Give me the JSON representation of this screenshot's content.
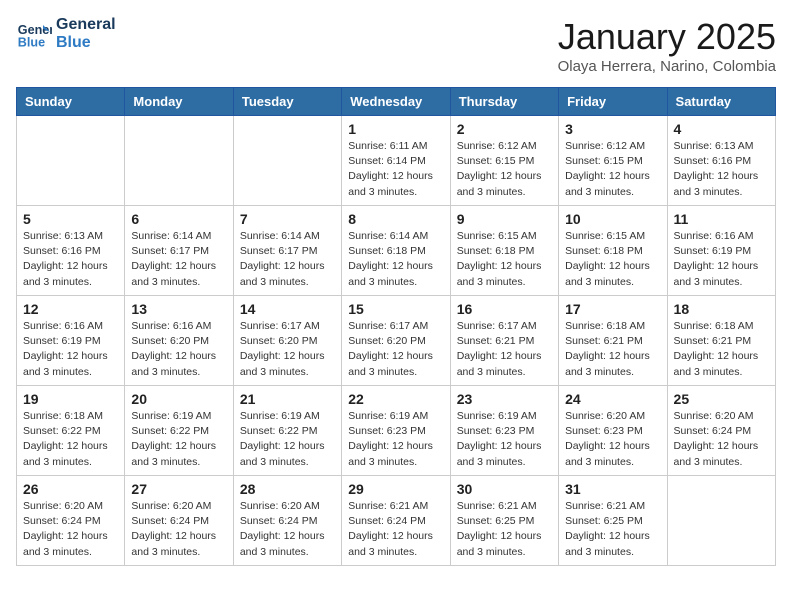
{
  "header": {
    "logo_line1": "General",
    "logo_line2": "Blue",
    "title": "January 2025",
    "subtitle": "Olaya Herrera, Narino, Colombia"
  },
  "weekdays": [
    "Sunday",
    "Monday",
    "Tuesday",
    "Wednesday",
    "Thursday",
    "Friday",
    "Saturday"
  ],
  "weeks": [
    [
      {
        "day": null,
        "info": null
      },
      {
        "day": null,
        "info": null
      },
      {
        "day": null,
        "info": null
      },
      {
        "day": "1",
        "info": "Sunrise: 6:11 AM\nSunset: 6:14 PM\nDaylight: 12 hours\nand 3 minutes."
      },
      {
        "day": "2",
        "info": "Sunrise: 6:12 AM\nSunset: 6:15 PM\nDaylight: 12 hours\nand 3 minutes."
      },
      {
        "day": "3",
        "info": "Sunrise: 6:12 AM\nSunset: 6:15 PM\nDaylight: 12 hours\nand 3 minutes."
      },
      {
        "day": "4",
        "info": "Sunrise: 6:13 AM\nSunset: 6:16 PM\nDaylight: 12 hours\nand 3 minutes."
      }
    ],
    [
      {
        "day": "5",
        "info": "Sunrise: 6:13 AM\nSunset: 6:16 PM\nDaylight: 12 hours\nand 3 minutes."
      },
      {
        "day": "6",
        "info": "Sunrise: 6:14 AM\nSunset: 6:17 PM\nDaylight: 12 hours\nand 3 minutes."
      },
      {
        "day": "7",
        "info": "Sunrise: 6:14 AM\nSunset: 6:17 PM\nDaylight: 12 hours\nand 3 minutes."
      },
      {
        "day": "8",
        "info": "Sunrise: 6:14 AM\nSunset: 6:18 PM\nDaylight: 12 hours\nand 3 minutes."
      },
      {
        "day": "9",
        "info": "Sunrise: 6:15 AM\nSunset: 6:18 PM\nDaylight: 12 hours\nand 3 minutes."
      },
      {
        "day": "10",
        "info": "Sunrise: 6:15 AM\nSunset: 6:18 PM\nDaylight: 12 hours\nand 3 minutes."
      },
      {
        "day": "11",
        "info": "Sunrise: 6:16 AM\nSunset: 6:19 PM\nDaylight: 12 hours\nand 3 minutes."
      }
    ],
    [
      {
        "day": "12",
        "info": "Sunrise: 6:16 AM\nSunset: 6:19 PM\nDaylight: 12 hours\nand 3 minutes."
      },
      {
        "day": "13",
        "info": "Sunrise: 6:16 AM\nSunset: 6:20 PM\nDaylight: 12 hours\nand 3 minutes."
      },
      {
        "day": "14",
        "info": "Sunrise: 6:17 AM\nSunset: 6:20 PM\nDaylight: 12 hours\nand 3 minutes."
      },
      {
        "day": "15",
        "info": "Sunrise: 6:17 AM\nSunset: 6:20 PM\nDaylight: 12 hours\nand 3 minutes."
      },
      {
        "day": "16",
        "info": "Sunrise: 6:17 AM\nSunset: 6:21 PM\nDaylight: 12 hours\nand 3 minutes."
      },
      {
        "day": "17",
        "info": "Sunrise: 6:18 AM\nSunset: 6:21 PM\nDaylight: 12 hours\nand 3 minutes."
      },
      {
        "day": "18",
        "info": "Sunrise: 6:18 AM\nSunset: 6:21 PM\nDaylight: 12 hours\nand 3 minutes."
      }
    ],
    [
      {
        "day": "19",
        "info": "Sunrise: 6:18 AM\nSunset: 6:22 PM\nDaylight: 12 hours\nand 3 minutes."
      },
      {
        "day": "20",
        "info": "Sunrise: 6:19 AM\nSunset: 6:22 PM\nDaylight: 12 hours\nand 3 minutes."
      },
      {
        "day": "21",
        "info": "Sunrise: 6:19 AM\nSunset: 6:22 PM\nDaylight: 12 hours\nand 3 minutes."
      },
      {
        "day": "22",
        "info": "Sunrise: 6:19 AM\nSunset: 6:23 PM\nDaylight: 12 hours\nand 3 minutes."
      },
      {
        "day": "23",
        "info": "Sunrise: 6:19 AM\nSunset: 6:23 PM\nDaylight: 12 hours\nand 3 minutes."
      },
      {
        "day": "24",
        "info": "Sunrise: 6:20 AM\nSunset: 6:23 PM\nDaylight: 12 hours\nand 3 minutes."
      },
      {
        "day": "25",
        "info": "Sunrise: 6:20 AM\nSunset: 6:24 PM\nDaylight: 12 hours\nand 3 minutes."
      }
    ],
    [
      {
        "day": "26",
        "info": "Sunrise: 6:20 AM\nSunset: 6:24 PM\nDaylight: 12 hours\nand 3 minutes."
      },
      {
        "day": "27",
        "info": "Sunrise: 6:20 AM\nSunset: 6:24 PM\nDaylight: 12 hours\nand 3 minutes."
      },
      {
        "day": "28",
        "info": "Sunrise: 6:20 AM\nSunset: 6:24 PM\nDaylight: 12 hours\nand 3 minutes."
      },
      {
        "day": "29",
        "info": "Sunrise: 6:21 AM\nSunset: 6:24 PM\nDaylight: 12 hours\nand 3 minutes."
      },
      {
        "day": "30",
        "info": "Sunrise: 6:21 AM\nSunset: 6:25 PM\nDaylight: 12 hours\nand 3 minutes."
      },
      {
        "day": "31",
        "info": "Sunrise: 6:21 AM\nSunset: 6:25 PM\nDaylight: 12 hours\nand 3 minutes."
      },
      {
        "day": null,
        "info": null
      }
    ]
  ]
}
